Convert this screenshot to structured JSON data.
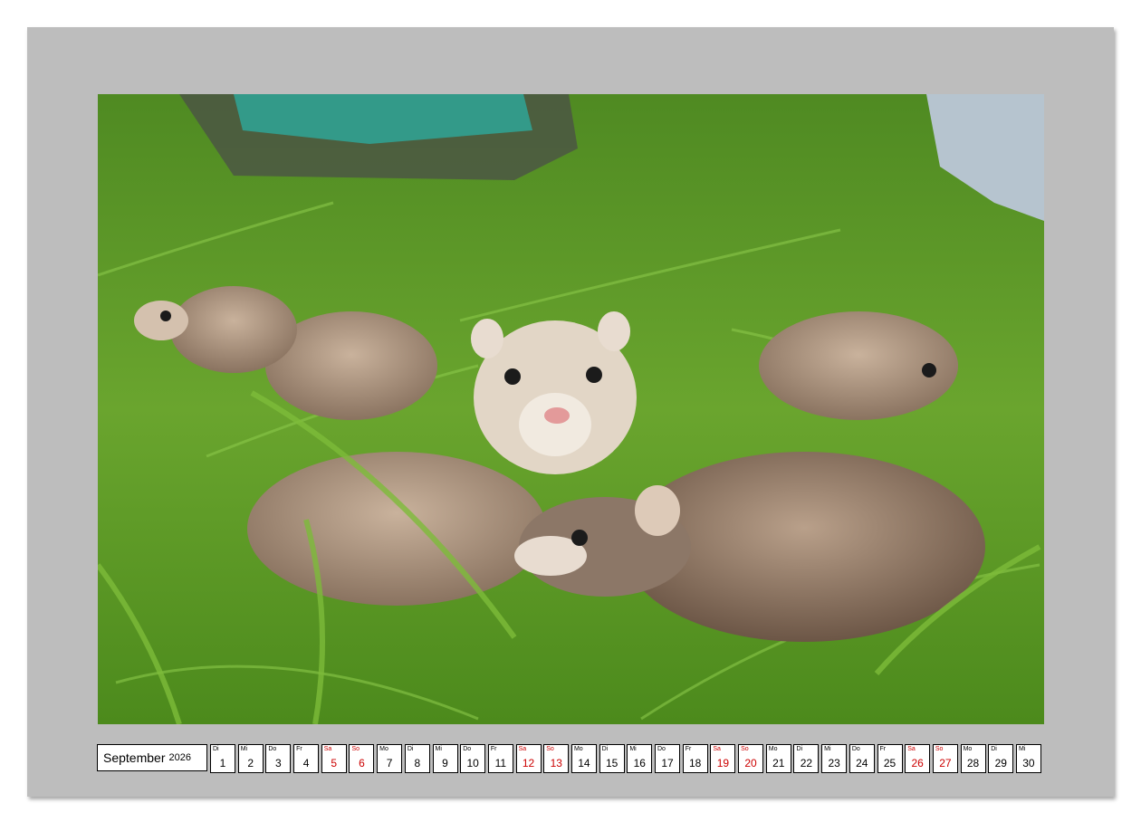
{
  "photo": {
    "subject": "ferret-kits-in-grass"
  },
  "calendar": {
    "month": "September",
    "year": "2026",
    "weekend_color": "#cc0000",
    "days": [
      {
        "wd": "Di",
        "d": "1",
        "we": false
      },
      {
        "wd": "Mi",
        "d": "2",
        "we": false
      },
      {
        "wd": "Do",
        "d": "3",
        "we": false
      },
      {
        "wd": "Fr",
        "d": "4",
        "we": false
      },
      {
        "wd": "Sa",
        "d": "5",
        "we": true
      },
      {
        "wd": "So",
        "d": "6",
        "we": true
      },
      {
        "wd": "Mo",
        "d": "7",
        "we": false
      },
      {
        "wd": "Di",
        "d": "8",
        "we": false
      },
      {
        "wd": "Mi",
        "d": "9",
        "we": false
      },
      {
        "wd": "Do",
        "d": "10",
        "we": false
      },
      {
        "wd": "Fr",
        "d": "11",
        "we": false
      },
      {
        "wd": "Sa",
        "d": "12",
        "we": true
      },
      {
        "wd": "So",
        "d": "13",
        "we": true
      },
      {
        "wd": "Mo",
        "d": "14",
        "we": false
      },
      {
        "wd": "Di",
        "d": "15",
        "we": false
      },
      {
        "wd": "Mi",
        "d": "16",
        "we": false
      },
      {
        "wd": "Do",
        "d": "17",
        "we": false
      },
      {
        "wd": "Fr",
        "d": "18",
        "we": false
      },
      {
        "wd": "Sa",
        "d": "19",
        "we": true
      },
      {
        "wd": "So",
        "d": "20",
        "we": true
      },
      {
        "wd": "Mo",
        "d": "21",
        "we": false
      },
      {
        "wd": "Di",
        "d": "22",
        "we": false
      },
      {
        "wd": "Mi",
        "d": "23",
        "we": false
      },
      {
        "wd": "Do",
        "d": "24",
        "we": false
      },
      {
        "wd": "Fr",
        "d": "25",
        "we": false
      },
      {
        "wd": "Sa",
        "d": "26",
        "we": true
      },
      {
        "wd": "So",
        "d": "27",
        "we": true
      },
      {
        "wd": "Mo",
        "d": "28",
        "we": false
      },
      {
        "wd": "Di",
        "d": "29",
        "we": false
      },
      {
        "wd": "Mi",
        "d": "30",
        "we": false
      }
    ]
  }
}
